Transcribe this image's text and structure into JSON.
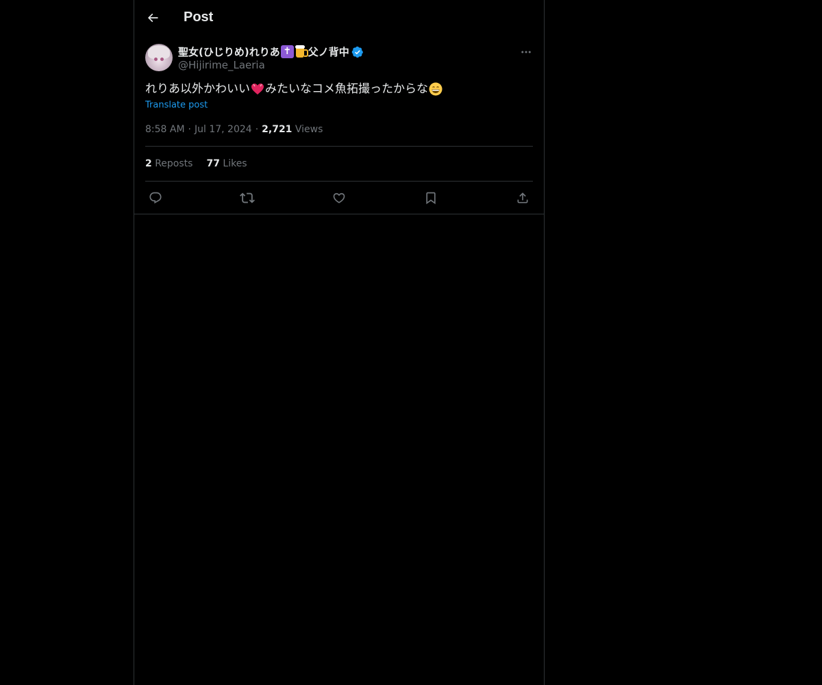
{
  "header": {
    "title": "Post"
  },
  "post": {
    "author": {
      "display_name": "聖女(ひじりめ)れりあ",
      "display_name_suffix": "父ノ背中",
      "handle": "@Hijirime_Laeria"
    },
    "text_part1": "れりあ以外かわいい",
    "text_part2": "みたいなコメ魚拓撮ったからな",
    "translate_label": "Translate post",
    "time": "8:58 AM",
    "date": "Jul 17, 2024",
    "views_count": "2,721",
    "views_label": "Views",
    "reposts_count": "2",
    "reposts_label": "Reposts",
    "likes_count": "77",
    "likes_label": "Likes"
  },
  "colors": {
    "background": "#000000",
    "border": "#2f3336",
    "primary_text": "#e7e9ea",
    "secondary_text": "#71767b",
    "accent": "#1d9bf0"
  },
  "icons": {
    "back": "back-arrow-icon",
    "more": "more-icon",
    "verified": "verified-badge-icon",
    "reply": "reply-icon",
    "repost": "repost-icon",
    "like": "heart-icon",
    "bookmark": "bookmark-icon",
    "share": "share-icon"
  }
}
